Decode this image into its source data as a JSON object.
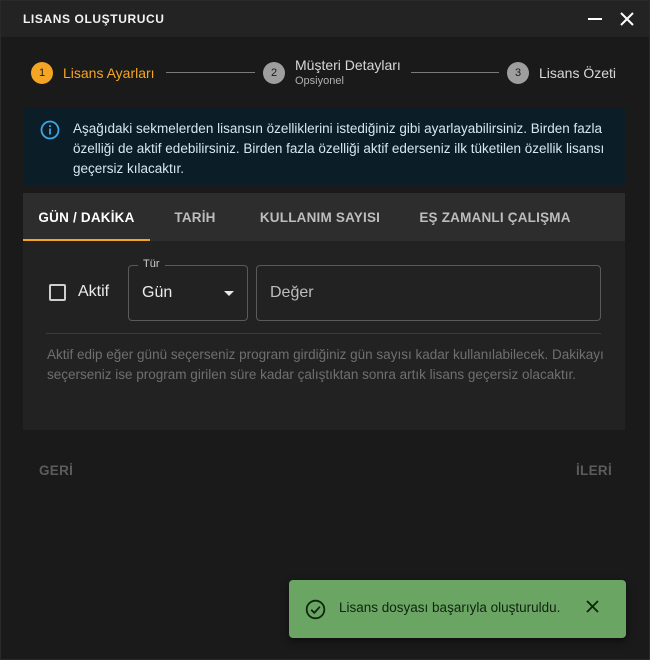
{
  "window": {
    "title": "LISANS OLUŞTURUCU"
  },
  "stepper": {
    "steps": [
      {
        "number": "1",
        "label": "Lisans Ayarları",
        "sub": "",
        "state": "active"
      },
      {
        "number": "2",
        "label": "Müşteri Detayları",
        "sub": "Opsiyonel",
        "state": "inactive"
      },
      {
        "number": "3",
        "label": "Lisans Özeti",
        "sub": "",
        "state": "inactive"
      }
    ]
  },
  "alert": {
    "icon": "info-icon",
    "text": "Aşağıdaki sekmelerden lisansın özelliklerini istediğiniz gibi ayarlayabilirsiniz. Birden fazla özelliği de aktif edebilirsiniz. Birden fazla özelliği aktif ederseniz ilk tüketilen özellik lisansı geçersiz kılacaktır."
  },
  "tabs": [
    {
      "label": "GÜN / DAKİKA",
      "active": true
    },
    {
      "label": "TARİH",
      "active": false
    },
    {
      "label": "KULLANIM SAYISI",
      "active": false
    },
    {
      "label": "EŞ ZAMANLI ÇALIŞMA",
      "active": false
    }
  ],
  "form": {
    "active_label": "Aktif",
    "active_checked": false,
    "type_label": "Tür",
    "type_value": "Gün",
    "value_placeholder": "Değer",
    "value_value": "",
    "helper": "Aktif edip eğer günü seçerseniz program girdiğiniz gün sayısı kadar kullanılabilecek. Dakikayı seçerseniz ise program girilen süre kadar çalıştıktan sonra artık lisans geçersiz olacaktır."
  },
  "nav": {
    "back": "GERİ",
    "next": "İLERİ"
  },
  "snackbar": {
    "message": "Lisans dosyası başarıyla oluşturuldu.",
    "icon": "check-circle-icon"
  },
  "colors": {
    "accent": "#f5a524",
    "inactive_step": "#9e9e9e",
    "alert_bg": "#0b1e27",
    "success": "#6aa563"
  }
}
